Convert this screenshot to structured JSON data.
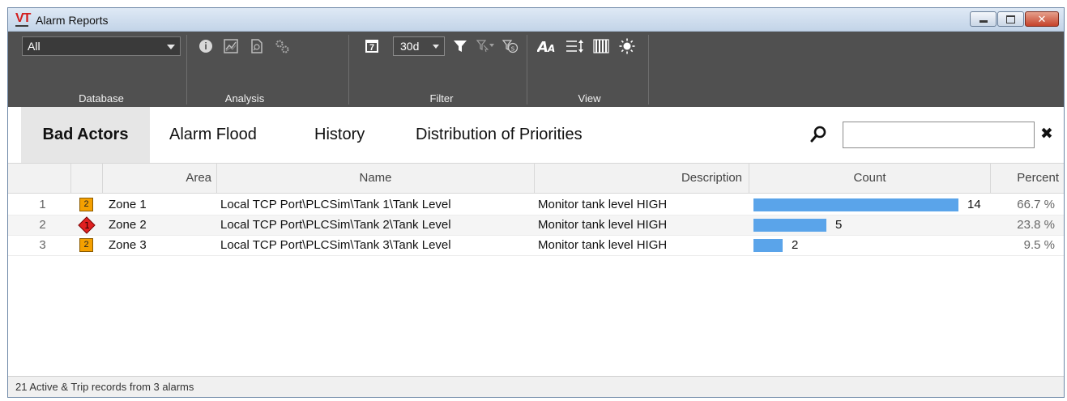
{
  "window": {
    "logo_text": "VT",
    "title": "Alarm Reports",
    "minimize_icon": "minimize-icon",
    "maximize_icon": "maximize-icon",
    "close_glyph": "✕"
  },
  "toolbar": {
    "database": {
      "selected": "All",
      "label": "Database"
    },
    "analysis": {
      "label": "Analysis",
      "icons": [
        "info-icon",
        "trend-chart-icon",
        "report-document-icon",
        "settings-gears-icon"
      ]
    },
    "filter": {
      "label": "Filter",
      "range_selected": "30d",
      "icons": [
        "calendar-icon",
        "filter-icon",
        "filter-select-icon",
        "filter-s-icon"
      ],
      "calendar_day": "7"
    },
    "view": {
      "label": "View",
      "icons": [
        "font-size-icon",
        "row-height-icon",
        "columns-icon",
        "brightness-icon"
      ]
    }
  },
  "tabs": [
    {
      "label": "Bad Actors",
      "active": true
    },
    {
      "label": "Alarm Flood",
      "active": false
    },
    {
      "label": "History",
      "active": false
    },
    {
      "label": "Distribution of Priorities",
      "active": false
    }
  ],
  "search": {
    "value": "",
    "placeholder": "",
    "clear_glyph": "✖"
  },
  "columns": {
    "area": "Area",
    "name": "Name",
    "description": "Description",
    "count": "Count",
    "percent": "Percent"
  },
  "rows": [
    {
      "num": "1",
      "priority": "2",
      "priority_shape": "square",
      "area": "Zone 1",
      "name": "Local TCP Port\\PLCSim\\Tank 1\\Tank Level",
      "description": "Monitor tank level  HIGH",
      "count": "14",
      "count_fraction": 1.0,
      "percent": "66.7 %"
    },
    {
      "num": "2",
      "priority": "1",
      "priority_shape": "diamond",
      "area": "Zone 2",
      "name": "Local TCP Port\\PLCSim\\Tank 2\\Tank Level",
      "description": "Monitor tank level HIGH",
      "count": "5",
      "count_fraction": 0.357,
      "percent": "23.8 %"
    },
    {
      "num": "3",
      "priority": "2",
      "priority_shape": "square",
      "area": "Zone 3",
      "name": "Local TCP Port\\PLCSim\\Tank 3\\Tank Level",
      "description": "Monitor tank level HIGH",
      "count": "2",
      "count_fraction": 0.143,
      "percent": "9.5 %"
    }
  ],
  "colors": {
    "bar": "#5aa4ea",
    "priority_2": "#f5a000",
    "priority_1": "#e02020",
    "toolbar_bg": "#505050"
  },
  "status": {
    "text": "21 Active & Trip records from 3 alarms"
  }
}
